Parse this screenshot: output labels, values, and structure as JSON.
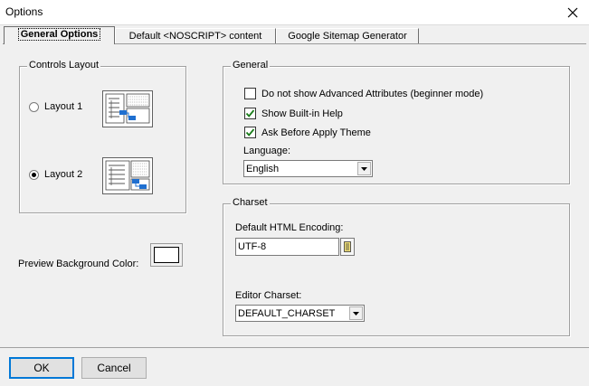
{
  "window": {
    "title": "Options",
    "close_icon": "close-icon"
  },
  "tabs": [
    {
      "label": "General Options",
      "active": true
    },
    {
      "label": "Default <NOSCRIPT> content",
      "active": false
    },
    {
      "label": "Google Sitemap Generator",
      "active": false
    }
  ],
  "controls_layout": {
    "legend": "Controls Layout",
    "options": [
      {
        "label": "Layout 1",
        "checked": false,
        "thumb_icon": "layout-1-preview-icon"
      },
      {
        "label": "Layout 2",
        "checked": true,
        "thumb_icon": "layout-2-preview-icon"
      }
    ]
  },
  "preview_background": {
    "label": "Preview Background Color:",
    "color": "#ffffff"
  },
  "general": {
    "legend": "General",
    "checkboxes": [
      {
        "label": "Do not show Advanced Attributes (beginner mode)",
        "checked": false
      },
      {
        "label": "Show Built-in Help",
        "checked": true
      },
      {
        "label": "Ask Before Apply Theme",
        "checked": true
      }
    ],
    "language_label": "Language:",
    "language_value": "English"
  },
  "charset": {
    "legend": "Charset",
    "encoding_label": "Default HTML Encoding:",
    "encoding_value": "UTF-8",
    "editor_label": "Editor Charset:",
    "editor_value": "DEFAULT_CHARSET"
  },
  "buttons": {
    "ok": "OK",
    "cancel": "Cancel"
  },
  "colors": {
    "check_mark": "#1a7d1a",
    "thumb_blue": "#1f6fd0",
    "focus_blue": "#0078d7"
  }
}
